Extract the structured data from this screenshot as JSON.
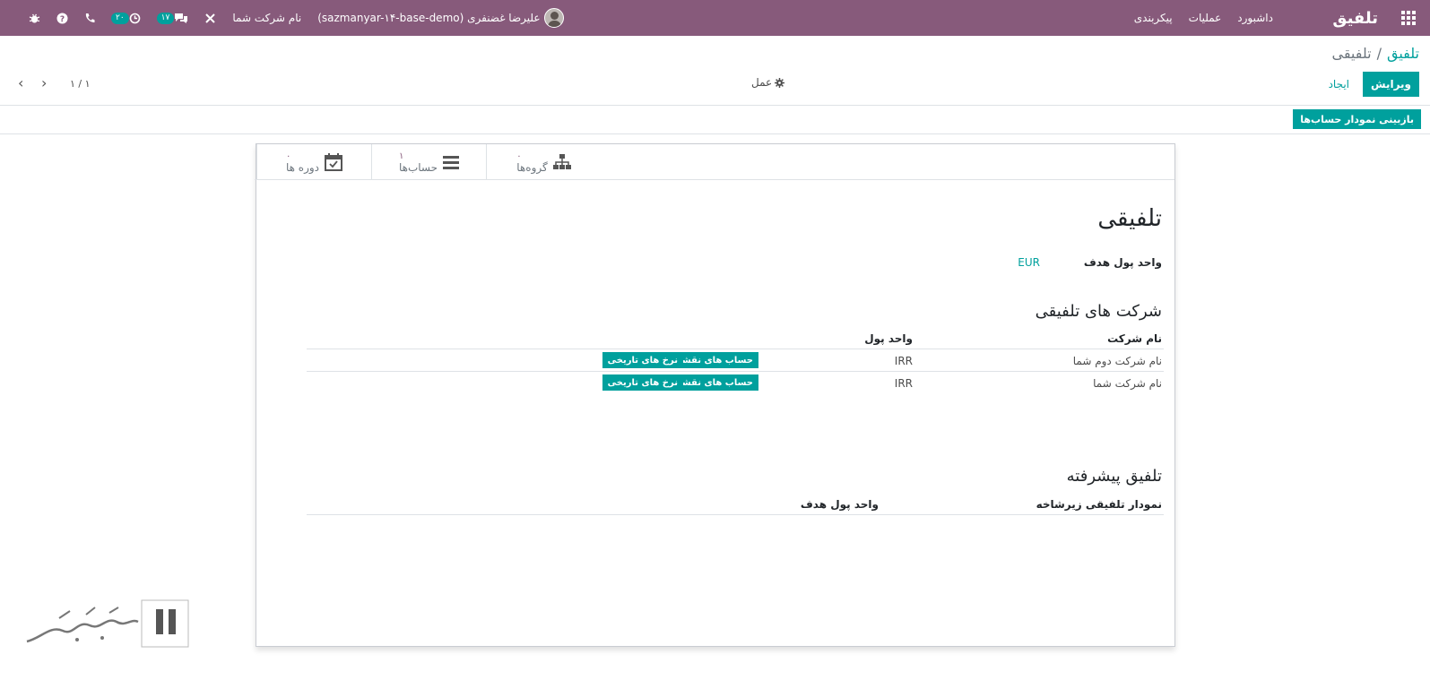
{
  "navbar": {
    "brand": "تلفیق",
    "menu": [
      "داشبورد",
      "عملیات",
      "پیکربندی"
    ],
    "company_switcher": "نام شرکت شما",
    "messages_count": "۱۷",
    "activities_count": "۲۰",
    "user_name": "علیرضا غضنفری (sazmanyar-۱۴-base-demo)",
    "bg_color": "#875a7b"
  },
  "breadcrumb": {
    "parent": "تلفیق",
    "separator": "/",
    "current": "تلفیقی"
  },
  "control": {
    "edit_label": "ویرایش",
    "create_label": "ایجاد",
    "action_label": "عمل",
    "pager_value": "۱ / ۱"
  },
  "statusbar": {
    "review_button": "بازبینی نمودار حساب‌ها"
  },
  "smart_buttons": [
    {
      "value": "۰",
      "label": "گروه‌ها",
      "icon": "sitemap-icon"
    },
    {
      "value": "۱",
      "label": "حساب‌ها",
      "icon": "list-icon"
    },
    {
      "value": "۰",
      "label": "دوره ها",
      "icon": "calendar-check-icon"
    }
  ],
  "form": {
    "title": "تلفیقی",
    "target_currency_label": "واحد پول هدف",
    "target_currency_value": "EUR",
    "companies_section": "شرکت های تلفیقی",
    "companies_columns": {
      "company": "نام شرکت",
      "currency": "واحد پول"
    },
    "companies_rows": [
      {
        "company": "نام شرکت دوم شما",
        "currency": "IRR",
        "btn_accounts": "حساب های نقشه",
        "btn_rates": "نرخ های تاریخی"
      },
      {
        "company": "نام شرکت شما",
        "currency": "IRR",
        "btn_accounts": "حساب های نقشه",
        "btn_rates": "نرخ های تاریخی"
      }
    ],
    "advanced_section": "تلفیق پیشرفته",
    "advanced_columns": {
      "chart": "نمودار تلفیقی زیرشاخه",
      "currency": "واحد پول هدف"
    }
  },
  "colors": {
    "primary": "#00a09d",
    "brand": "#875a7b"
  }
}
